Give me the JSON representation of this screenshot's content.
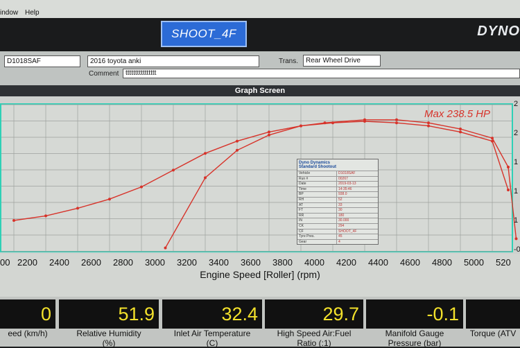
{
  "menu": {
    "window": "indow",
    "help": "Help"
  },
  "header": {
    "run_name": "SHOOT_4F",
    "logo": "DYNO"
  },
  "info": {
    "vehicle_id": "D1018SAF",
    "description": "2016 toyota anki",
    "trans_label": "Trans.",
    "trans_value": "Rear Wheel Drive",
    "comment_label": "Comment",
    "comment_value": "tttttttttttttttt"
  },
  "graph": {
    "title": "Graph Screen",
    "max_label": "Max 238.5 HP",
    "x_axis_title": "Engine Speed [Roller] (rpm)",
    "x_ticks": [
      "00",
      "2200",
      "2400",
      "2600",
      "2800",
      "3000",
      "3200",
      "3400",
      "3600",
      "3800",
      "4000",
      "4200",
      "4400",
      "4600",
      "4800",
      "5000",
      "520"
    ],
    "right_ticks": [
      "2",
      "2",
      "1",
      "1",
      "1",
      "-0"
    ]
  },
  "shootout_box": {
    "title1": "Dyno Dynamics",
    "title2": "Standard Shootout",
    "rows": [
      {
        "k": "Vehicle",
        "v": "D1018SAF"
      },
      {
        "k": "Run #",
        "v": "00267"
      },
      {
        "k": "Date",
        "v": "2019-03-13"
      },
      {
        "k": "Time",
        "v": "14:35:46"
      },
      {
        "k": "BP",
        "v": "938.0"
      },
      {
        "k": "RH",
        "v": "52"
      },
      {
        "k": "AT",
        "v": "33"
      },
      {
        "k": "FT",
        "v": "30"
      },
      {
        "k": "RR",
        "v": "180"
      },
      {
        "k": "IN",
        "v": "30.000"
      },
      {
        "k": "CK",
        "v": "294"
      },
      {
        "k": "CF",
        "v": "SHOOT_4F"
      },
      {
        "k": "Tyre Pres.",
        "v": "45"
      },
      {
        "k": "Gear",
        "v": "4"
      }
    ]
  },
  "gauges": [
    {
      "value": "0",
      "label1": "eed (km/h)",
      "label2": ""
    },
    {
      "value": "51.9",
      "label1": "Relative Humidity",
      "label2": "(%)"
    },
    {
      "value": "32.4",
      "label1": "Inlet Air Temperature",
      "label2": "(C)"
    },
    {
      "value": "29.7",
      "label1": "High Speed Air:Fuel",
      "label2": "Ratio (:1)"
    },
    {
      "value": "-0.1",
      "label1": "Manifold Gauge",
      "label2": "Pressure (bar)"
    },
    {
      "value": "",
      "label1": "Torque (ATV",
      "label2": ""
    }
  ],
  "chart_data": {
    "type": "line",
    "xlabel": "Engine Speed [Roller] (rpm)",
    "xlim": [
      2000,
      5200
    ],
    "series": [
      {
        "x": [
          2000,
          2200,
          2400,
          2600,
          2800,
          3000,
          3200,
          3400,
          3600,
          3800,
          4000,
          4200,
          4400,
          4600,
          4800,
          5000,
          5100
        ],
        "y": [
          0.2,
          0.23,
          0.28,
          0.34,
          0.42,
          0.53,
          0.64,
          0.72,
          0.78,
          0.82,
          0.84,
          0.85,
          0.84,
          0.82,
          0.78,
          0.72,
          0.4
        ]
      },
      {
        "x": [
          2950,
          3200,
          3400,
          3600,
          3800,
          3950,
          4200,
          4400,
          4600,
          4800,
          5000,
          5100,
          5150
        ],
        "y": [
          0.02,
          0.48,
          0.66,
          0.76,
          0.82,
          0.84,
          0.86,
          0.86,
          0.84,
          0.8,
          0.74,
          0.55,
          0.08
        ]
      }
    ]
  }
}
